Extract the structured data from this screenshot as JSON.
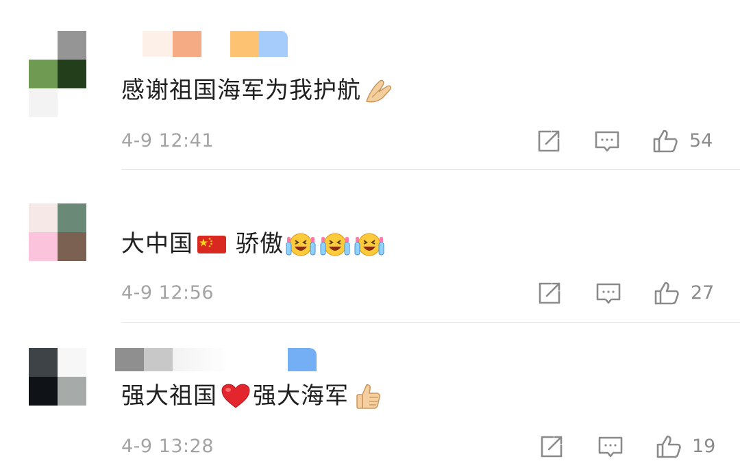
{
  "comments": [
    {
      "text": "感谢祖国海军为我护航",
      "emoji_after": "folded-hands-emoji",
      "time": "4-9 12:41",
      "likes": "54",
      "avatar_colors": [
        "#ffffff",
        "#959595",
        "#6e9a52",
        "#223e1a",
        "#f4f4f4",
        "#ffffff"
      ],
      "name_colors": [
        "#ffffff",
        "#fbeee6",
        "#f5ae86",
        "#ffffff",
        "#fcc26f",
        "#a7cdfd"
      ]
    },
    {
      "text_before": "大中国",
      "flag": "china-flag-emoji",
      "text_after": "骄傲",
      "emoji_after": "laughing-crying-emoji",
      "emoji_count": 3,
      "time": "4-9 12:56",
      "likes": "27",
      "avatar_colors": [
        "#f7e8e8",
        "#6a8a77",
        "#fbc3dc",
        "#7b6152"
      ]
    },
    {
      "text_before": "强大祖国",
      "heart": "red-heart-emoji",
      "text_after": "强大海军",
      "emoji_after": "thumbs-up-emoji",
      "time": "4-9 13:28",
      "likes": "19",
      "avatar_colors": [
        "#3e4347",
        "#f7f7f7",
        "#0f1318",
        "#a6aaa8"
      ],
      "name_colors": [
        "#8f8f8f",
        "#c8c8c8",
        "#ffffff",
        "#ffffff",
        "#73aef5"
      ]
    }
  ],
  "icons": {
    "share": "share-icon",
    "reply": "comment-icon",
    "like": "thumbs-up-outline-icon"
  },
  "colors": {
    "time_text": "#a3a3a3",
    "icon_stroke": "#8a8a8a",
    "divider": "#e6e6e6"
  }
}
